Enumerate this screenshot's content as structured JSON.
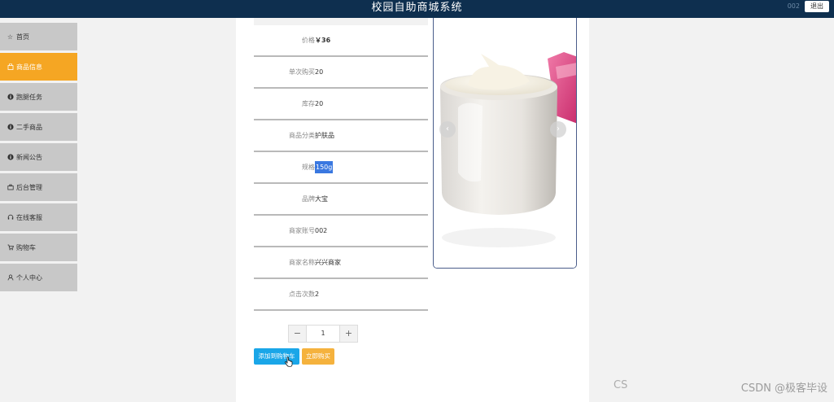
{
  "header": {
    "title": "校园自助商城系统",
    "username": "002",
    "logout_label": "退出"
  },
  "sidebar": {
    "items": [
      {
        "label": "首页",
        "icon": "star-icon",
        "active": false
      },
      {
        "label": "商品信息",
        "icon": "bag-icon",
        "active": true
      },
      {
        "label": "跑腿任务",
        "icon": "info-icon",
        "active": false
      },
      {
        "label": "二手商品",
        "icon": "info-icon",
        "active": false
      },
      {
        "label": "新闻公告",
        "icon": "info-icon",
        "active": false
      },
      {
        "label": "后台管理",
        "icon": "briefcase-icon",
        "active": false
      },
      {
        "label": "在线客服",
        "icon": "headset-icon",
        "active": false
      },
      {
        "label": "购物车",
        "icon": "cart-icon",
        "active": false
      },
      {
        "label": "个人中心",
        "icon": "user-icon",
        "active": false
      }
    ]
  },
  "product": {
    "fields": [
      {
        "label": "价格",
        "value": "￥36"
      },
      {
        "label": "单次购买",
        "value": "20"
      },
      {
        "label": "库存",
        "value": "20"
      },
      {
        "label": "商品分类",
        "value": "护肤品"
      },
      {
        "label": "规格",
        "value": "150g"
      },
      {
        "label": "品牌",
        "value": "大宝"
      },
      {
        "label": "商家账号",
        "value": "002"
      },
      {
        "label": "商家名称",
        "value": "兴兴商家"
      },
      {
        "label": "点击次数",
        "value": "2"
      }
    ],
    "quantity": "1",
    "minus_label": "−",
    "plus_label": "+",
    "add_to_cart_label": "添加到购物车",
    "buy_now_label": "立即购买"
  },
  "carousel": {
    "image": "face-cream-jar",
    "prev_label": "‹",
    "next_label": "›"
  },
  "watermark": {
    "left": "CS",
    "text": "CSDN @极客毕设"
  },
  "colors": {
    "header_bg": "#0e2f4f",
    "active_nav": "#f5a623",
    "cart_button": "#1aa6e8",
    "buy_button": "#f5b23d"
  }
}
